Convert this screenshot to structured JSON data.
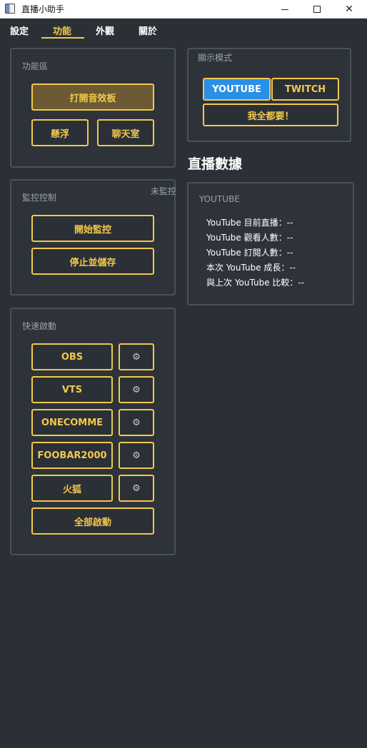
{
  "window": {
    "title": "直播小助手",
    "controls": {
      "minimize": "",
      "maximize": "",
      "close": "✕"
    }
  },
  "tabs": [
    {
      "label": "設定"
    },
    {
      "label": "功能",
      "active": true
    },
    {
      "label": "外觀"
    },
    {
      "label": "關於"
    }
  ],
  "function_area": {
    "title": "功能區",
    "soundboard": "打開音效板",
    "float": "懸浮",
    "chatroom": "聊天室"
  },
  "monitor": {
    "title": "監控控制",
    "status": "未監控",
    "start": "開始監控",
    "stop_save": "停止並儲存"
  },
  "quick_launch": {
    "title": "快速啟動",
    "apps": [
      {
        "label": "OBS",
        "icon": "gear-icon"
      },
      {
        "label": "VTS",
        "icon": "gear-icon"
      },
      {
        "label": "ONECOMME",
        "icon": "gear-icon"
      },
      {
        "label": "FOOBAR2000",
        "icon": "gear-icon"
      },
      {
        "label": "火狐",
        "icon": "gear-icon"
      }
    ],
    "gear_glyph": "⚙",
    "launch_all": "全部啟動"
  },
  "display_mode": {
    "title": "顯示模式",
    "youtube": "YOUTUBE",
    "twitch": "TWITCH",
    "all": "我全都要！"
  },
  "stream_data": {
    "heading": "直播數據",
    "panel_title": "YOUTUBE",
    "lines": [
      "YouTube 目前直播：--",
      "YouTube 觀看人數：--",
      "YouTube 訂閱人數：--",
      "本次 YouTube 成長：--",
      "與上次 YouTube 比較：--"
    ]
  },
  "colors": {
    "background": "#2b3036",
    "accent": "#f2c94c",
    "selected_mode": "#2a8fe6"
  }
}
